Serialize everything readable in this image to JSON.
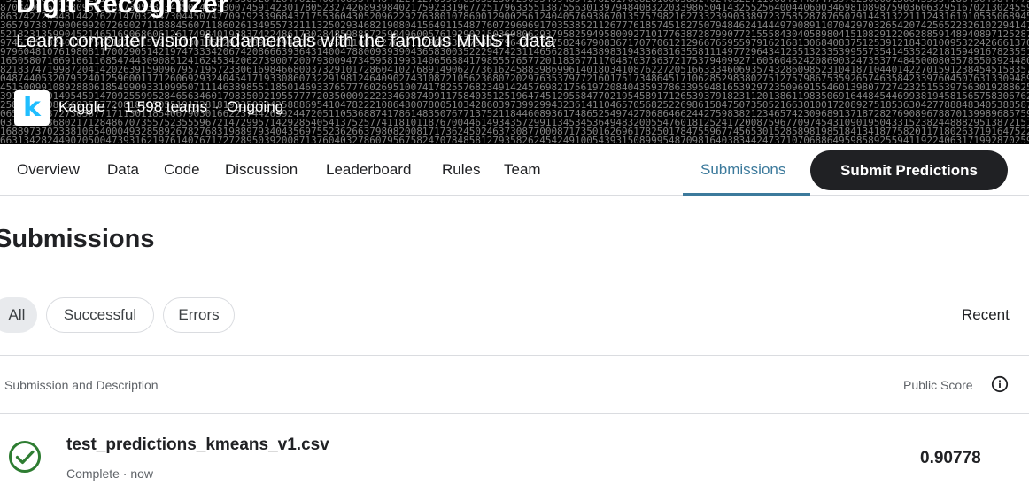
{
  "banner": {
    "title": "Digit Recognizer",
    "subtitle": "Learn computer vision fundamentals with the famous MNIST data",
    "logo_letter": "k",
    "host": "Kaggle",
    "teams": "1,598 teams",
    "status": "Ongoing",
    "separator": "·"
  },
  "tabs": {
    "overview": "Overview",
    "data": "Data",
    "code": "Code",
    "discussion": "Discussion",
    "leaderboard": "Leaderboard",
    "rules": "Rules",
    "team": "Team",
    "submissions": "Submissions"
  },
  "submit_button": "Submit Predictions",
  "more_icon": "⋮",
  "page_title": "Submissions",
  "filters": {
    "all": "All",
    "successful": "Successful",
    "errors": "Errors"
  },
  "sort": "Recent",
  "table": {
    "col_submission": "Submission and Description",
    "col_score": "Public Score",
    "rows": [
      {
        "file": "test_predictions_kmeans_v1.csv",
        "status": "Complete · now",
        "score": "0.90778"
      }
    ]
  },
  "colors": {
    "accent": "#3c7a9c",
    "success": "#2e7d32",
    "button": "#202124",
    "logo": "#20beff"
  },
  "icons": {
    "logo": "kaggle-logo",
    "info": "info-icon",
    "status": "check-circle-icon",
    "more": "more-vertical-icon"
  }
}
